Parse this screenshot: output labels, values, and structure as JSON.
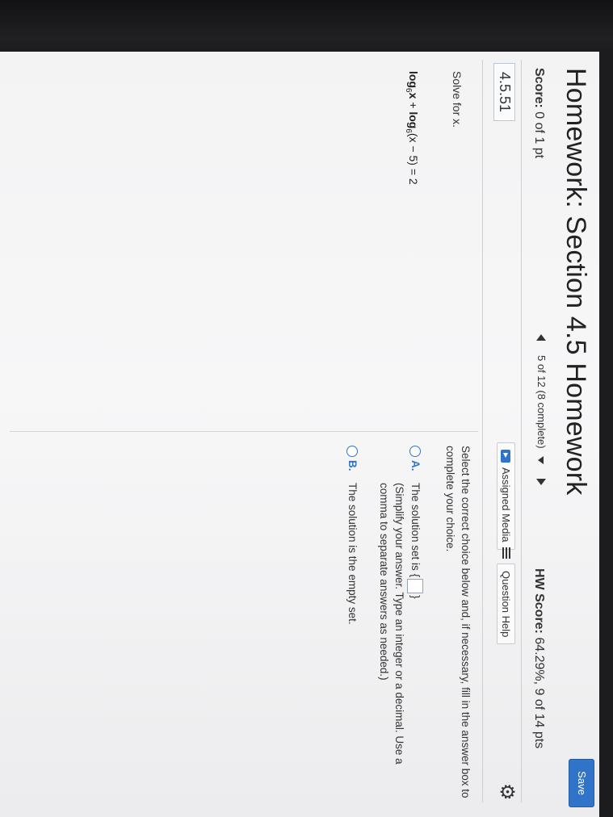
{
  "header": {
    "title": "Homework: Section 4.5 Homework",
    "save_label": "Save"
  },
  "score_row": {
    "score_label": "Score:",
    "score_value": "0 of 1 pt",
    "progress": "5 of 12 (8 complete)",
    "hw_score_label": "HW Score:",
    "hw_score_value": "64.29%, 9 of 14 pts"
  },
  "question": {
    "number": "4.5.51",
    "assigned_media": "Assigned Media",
    "question_help": "Question Help",
    "prompt": "Solve for x.",
    "equation": {
      "log1": "log",
      "base1": "6",
      "arg1": "x",
      "plus": " + ",
      "log2": "log",
      "base2": "6",
      "arg2": "(x − 5) = 2"
    }
  },
  "answer": {
    "instruction": "Select the correct choice below and, if necessary, fill in the answer box to complete your choice.",
    "choice_a": {
      "letter": "A.",
      "text_before": "The solution set is",
      "brace_open": "{",
      "brace_close": "}",
      "hint": "(Simplify your answer. Type an integer or a decimal. Use a comma to separate answers as needed.)"
    },
    "choice_b": {
      "letter": "B.",
      "text": "The solution is the empty set."
    }
  },
  "colors": {
    "accent": "#2f74c8",
    "screen": "#f4f4f5"
  }
}
